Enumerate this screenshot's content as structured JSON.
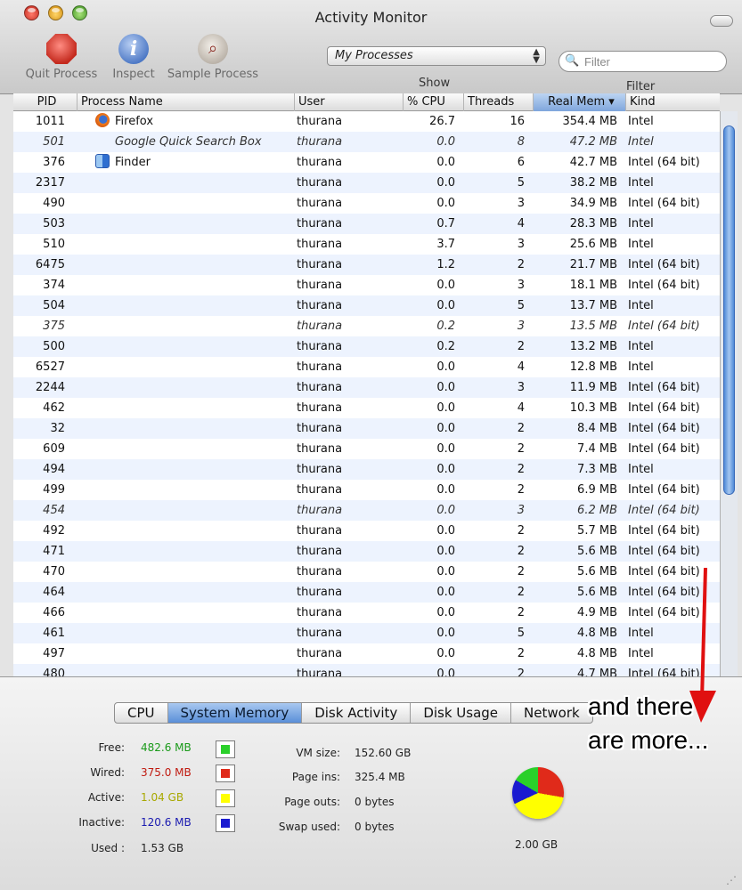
{
  "window": {
    "title": "Activity Monitor"
  },
  "toolbar": {
    "quit_label": "Quit Process",
    "inspect_label": "Inspect",
    "sample_label": "Sample Process",
    "show_label": "Show",
    "show_value": "My Processes",
    "filter_label": "Filter",
    "filter_placeholder": "Filter"
  },
  "columns": {
    "pid": "PID",
    "name": "Process Name",
    "user": "User",
    "cpu": "% CPU",
    "threads": "Threads",
    "mem": "Real Mem ▾",
    "kind": "Kind"
  },
  "processes": [
    {
      "pid": "1011",
      "name": "Firefox",
      "icon": "firefox-icon",
      "user": "thurana",
      "cpu": "26.7",
      "threads": "16",
      "mem": "354.4 MB",
      "kind": "Intel",
      "italic": false
    },
    {
      "pid": "501",
      "name": "Google Quick Search Box",
      "icon": "",
      "user": "thurana",
      "cpu": "0.0",
      "threads": "8",
      "mem": "47.2 MB",
      "kind": "Intel",
      "italic": true
    },
    {
      "pid": "376",
      "name": "Finder",
      "icon": "finder-icon",
      "user": "thurana",
      "cpu": "0.0",
      "threads": "6",
      "mem": "42.7 MB",
      "kind": "Intel (64 bit)",
      "italic": false
    },
    {
      "pid": "2317",
      "name": "",
      "icon": "",
      "user": "thurana",
      "cpu": "0.0",
      "threads": "5",
      "mem": "38.2 MB",
      "kind": "Intel",
      "italic": false
    },
    {
      "pid": "490",
      "name": "",
      "icon": "",
      "user": "thurana",
      "cpu": "0.0",
      "threads": "3",
      "mem": "34.9 MB",
      "kind": "Intel (64 bit)",
      "italic": false
    },
    {
      "pid": "503",
      "name": "",
      "icon": "",
      "user": "thurana",
      "cpu": "0.7",
      "threads": "4",
      "mem": "28.3 MB",
      "kind": "Intel",
      "italic": false
    },
    {
      "pid": "510",
      "name": "",
      "icon": "",
      "user": "thurana",
      "cpu": "3.7",
      "threads": "3",
      "mem": "25.6 MB",
      "kind": "Intel",
      "italic": false
    },
    {
      "pid": "6475",
      "name": "",
      "icon": "",
      "user": "thurana",
      "cpu": "1.2",
      "threads": "2",
      "mem": "21.7 MB",
      "kind": "Intel (64 bit)",
      "italic": false
    },
    {
      "pid": "374",
      "name": "",
      "icon": "",
      "user": "thurana",
      "cpu": "0.0",
      "threads": "3",
      "mem": "18.1 MB",
      "kind": "Intel (64 bit)",
      "italic": false
    },
    {
      "pid": "504",
      "name": "",
      "icon": "",
      "user": "thurana",
      "cpu": "0.0",
      "threads": "5",
      "mem": "13.7 MB",
      "kind": "Intel",
      "italic": false
    },
    {
      "pid": "375",
      "name": "",
      "icon": "",
      "user": "thurana",
      "cpu": "0.2",
      "threads": "3",
      "mem": "13.5 MB",
      "kind": "Intel (64 bit)",
      "italic": true
    },
    {
      "pid": "500",
      "name": "",
      "icon": "",
      "user": "thurana",
      "cpu": "0.2",
      "threads": "2",
      "mem": "13.2 MB",
      "kind": "Intel",
      "italic": false
    },
    {
      "pid": "6527",
      "name": "",
      "icon": "",
      "user": "thurana",
      "cpu": "0.0",
      "threads": "4",
      "mem": "12.8 MB",
      "kind": "Intel",
      "italic": false
    },
    {
      "pid": "2244",
      "name": "",
      "icon": "",
      "user": "thurana",
      "cpu": "0.0",
      "threads": "3",
      "mem": "11.9 MB",
      "kind": "Intel (64 bit)",
      "italic": false
    },
    {
      "pid": "462",
      "name": "",
      "icon": "",
      "user": "thurana",
      "cpu": "0.0",
      "threads": "4",
      "mem": "10.3 MB",
      "kind": "Intel (64 bit)",
      "italic": false
    },
    {
      "pid": "32",
      "name": "",
      "icon": "",
      "user": "thurana",
      "cpu": "0.0",
      "threads": "2",
      "mem": "8.4 MB",
      "kind": "Intel (64 bit)",
      "italic": false
    },
    {
      "pid": "609",
      "name": "",
      "icon": "",
      "user": "thurana",
      "cpu": "0.0",
      "threads": "2",
      "mem": "7.4 MB",
      "kind": "Intel (64 bit)",
      "italic": false
    },
    {
      "pid": "494",
      "name": "",
      "icon": "",
      "user": "thurana",
      "cpu": "0.0",
      "threads": "2",
      "mem": "7.3 MB",
      "kind": "Intel",
      "italic": false
    },
    {
      "pid": "499",
      "name": "",
      "icon": "",
      "user": "thurana",
      "cpu": "0.0",
      "threads": "2",
      "mem": "6.9 MB",
      "kind": "Intel (64 bit)",
      "italic": false
    },
    {
      "pid": "454",
      "name": "",
      "icon": "",
      "user": "thurana",
      "cpu": "0.0",
      "threads": "3",
      "mem": "6.2 MB",
      "kind": "Intel (64 bit)",
      "italic": true
    },
    {
      "pid": "492",
      "name": "",
      "icon": "",
      "user": "thurana",
      "cpu": "0.0",
      "threads": "2",
      "mem": "5.7 MB",
      "kind": "Intel (64 bit)",
      "italic": false
    },
    {
      "pid": "471",
      "name": "",
      "icon": "",
      "user": "thurana",
      "cpu": "0.0",
      "threads": "2",
      "mem": "5.6 MB",
      "kind": "Intel (64 bit)",
      "italic": false
    },
    {
      "pid": "470",
      "name": "",
      "icon": "",
      "user": "thurana",
      "cpu": "0.0",
      "threads": "2",
      "mem": "5.6 MB",
      "kind": "Intel (64 bit)",
      "italic": false
    },
    {
      "pid": "464",
      "name": "",
      "icon": "",
      "user": "thurana",
      "cpu": "0.0",
      "threads": "2",
      "mem": "5.6 MB",
      "kind": "Intel (64 bit)",
      "italic": false
    },
    {
      "pid": "466",
      "name": "",
      "icon": "",
      "user": "thurana",
      "cpu": "0.0",
      "threads": "2",
      "mem": "4.9 MB",
      "kind": "Intel (64 bit)",
      "italic": false
    },
    {
      "pid": "461",
      "name": "",
      "icon": "",
      "user": "thurana",
      "cpu": "0.0",
      "threads": "5",
      "mem": "4.8 MB",
      "kind": "Intel",
      "italic": false
    },
    {
      "pid": "497",
      "name": "",
      "icon": "",
      "user": "thurana",
      "cpu": "0.0",
      "threads": "2",
      "mem": "4.8 MB",
      "kind": "Intel",
      "italic": false
    },
    {
      "pid": "480",
      "name": "",
      "icon": "",
      "user": "thurana",
      "cpu": "0.0",
      "threads": "2",
      "mem": "4.7 MB",
      "kind": "Intel (64 bit)",
      "italic": false
    }
  ],
  "tabs": [
    {
      "label": "CPU",
      "active": false
    },
    {
      "label": "System Memory",
      "active": true
    },
    {
      "label": "Disk Activity",
      "active": false
    },
    {
      "label": "Disk Usage",
      "active": false
    },
    {
      "label": "Network",
      "active": false
    }
  ],
  "memory": {
    "free_label": "Free:",
    "free_value": "482.6 MB",
    "wired_label": "Wired:",
    "wired_value": "375.0 MB",
    "active_label": "Active:",
    "active_value": "1.04 GB",
    "inactive_label": "Inactive:",
    "inactive_value": "120.6 MB",
    "used_label": "Used :",
    "used_value": "1.53 GB",
    "vm_size_label": "VM size:",
    "vm_size_value": "152.60 GB",
    "page_ins_label": "Page ins:",
    "page_ins_value": "325.4 MB",
    "page_outs_label": "Page outs:",
    "page_outs_value": "0 bytes",
    "swap_used_label": "Swap used:",
    "swap_used_value": "0 bytes",
    "total": "2.00 GB",
    "colors": {
      "free": "#2ad02a",
      "wired": "#e02a1a",
      "active": "#ffff00",
      "inactive": "#1a1ad0"
    }
  },
  "annotation": {
    "text": "and there are more..."
  }
}
